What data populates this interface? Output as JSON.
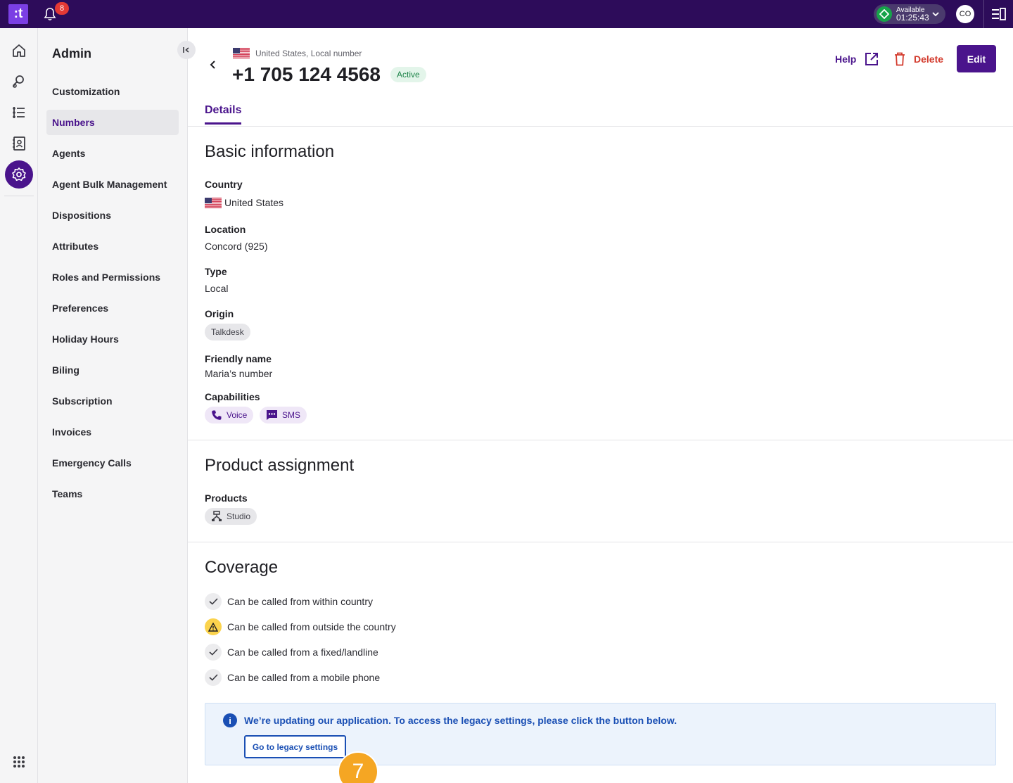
{
  "topbar": {
    "logo": ":t",
    "notifications": "8",
    "status": {
      "label": "Available",
      "timer": "01:25:43",
      "color": "#17a34a"
    },
    "avatar": "CO"
  },
  "rail": {
    "items": [
      "home-icon",
      "contact-icon",
      "list-icon",
      "address-book-icon",
      "settings-icon"
    ],
    "active": "settings-icon"
  },
  "sidebar": {
    "title": "Admin",
    "items": [
      {
        "label": "Customization"
      },
      {
        "label": "Numbers",
        "active": true
      },
      {
        "label": "Agents"
      },
      {
        "label": "Agent Bulk Management"
      },
      {
        "label": "Dispositions"
      },
      {
        "label": "Attributes"
      },
      {
        "label": "Roles and Permissions"
      },
      {
        "label": "Preferences"
      },
      {
        "label": "Holiday Hours"
      },
      {
        "label": "Biling"
      },
      {
        "label": "Subscription"
      },
      {
        "label": "Invoices"
      },
      {
        "label": "Emergency Calls"
      },
      {
        "label": "Teams"
      }
    ]
  },
  "header": {
    "meta": "United States, Local number",
    "number": "+1 705 124 4568",
    "status": "Active",
    "help": "Help",
    "delete": "Delete",
    "edit": "Edit",
    "accent": "#4a148c"
  },
  "tabs": {
    "details": "Details"
  },
  "basic": {
    "title": "Basic information",
    "country_label": "Country",
    "country": "United States",
    "location_label": "Location",
    "location": "Concord (925)",
    "type_label": "Type",
    "type": "Local",
    "origin_label": "Origin",
    "origin": "Talkdesk",
    "friendly_label": "Friendly name",
    "friendly": "Maria’s number",
    "capabilities_label": "Capabilities",
    "voice": "Voice",
    "sms": "SMS"
  },
  "product": {
    "title": "Product assignment",
    "products_label": "Products",
    "studio": "Studio"
  },
  "coverage": {
    "title": "Coverage",
    "items": [
      {
        "label": "Can be called from within country",
        "icon": "check-icon"
      },
      {
        "label": "Can be called from outside the country",
        "icon": "warning-icon"
      },
      {
        "label": "Can be called from a fixed/landline",
        "icon": "check-icon"
      },
      {
        "label": "Can be called from a mobile phone",
        "icon": "check-icon"
      }
    ]
  },
  "banner": {
    "text": "We’re updating our application. To access the legacy settings, please click the button below.",
    "button": "Go to legacy settings",
    "step": "7"
  }
}
